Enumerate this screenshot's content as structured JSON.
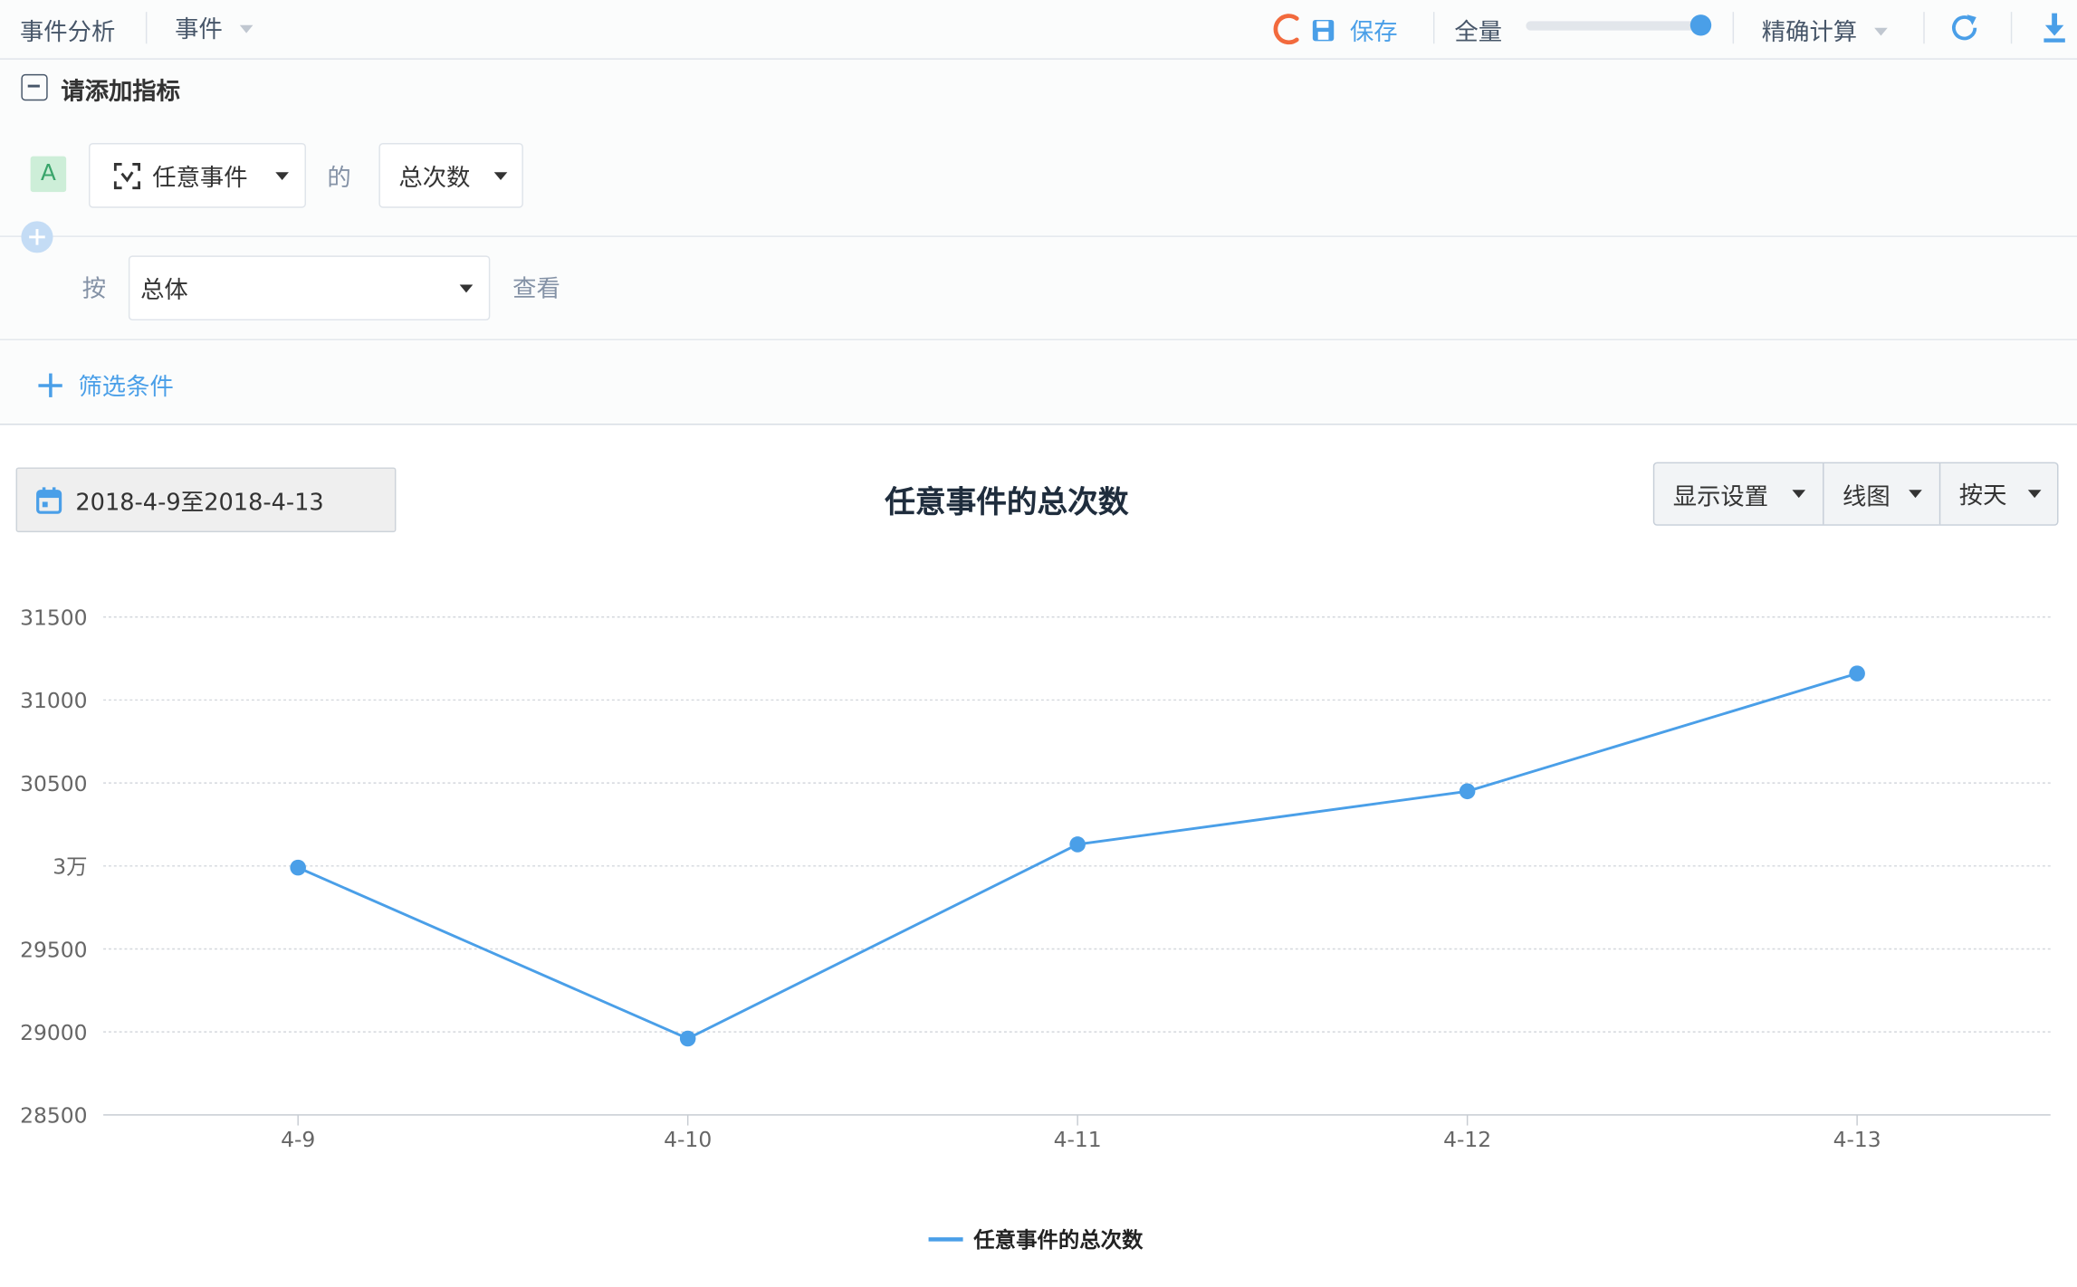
{
  "toolbar": {
    "title": "事件分析",
    "event_menu_label": "事件",
    "save_label": "保存",
    "sample_label": "全量",
    "sample_level": 1.0,
    "calc_label": "精确计算"
  },
  "metrics": {
    "header_label": "请添加指标",
    "metric_badge": "A",
    "event_select": "任意事件",
    "of_label": "的",
    "measure_select": "总次数"
  },
  "group": {
    "by_label": "按",
    "by_select": "总体",
    "view_label": "查看"
  },
  "filter": {
    "add_label": "筛选条件"
  },
  "report": {
    "date_range": "2018-4-9至2018-4-13",
    "title": "任意事件的总次数",
    "display_settings": "显示设置",
    "chart_type": "线图",
    "granularity": "按天"
  },
  "colors": {
    "accent": "#4a9fe8",
    "brand_orange": "#f26a3d",
    "badge_bg": "#cdeed8",
    "badge_fg": "#3aa56b"
  },
  "chart_data": {
    "type": "line",
    "categories": [
      "4-9",
      "4-10",
      "4-11",
      "4-12",
      "4-13"
    ],
    "series": [
      {
        "name": "任意事件的总次数",
        "values": [
          29990,
          28960,
          30130,
          30450,
          31160
        ]
      }
    ],
    "ylim": [
      28500,
      31500
    ],
    "yticks": [
      28500,
      29000,
      29500,
      30000,
      30500,
      31000,
      31500
    ],
    "ytick_labels": [
      "28500",
      "29000",
      "29500",
      "3万",
      "30500",
      "31000",
      "31500"
    ],
    "grid": true,
    "legend": "bottom"
  }
}
